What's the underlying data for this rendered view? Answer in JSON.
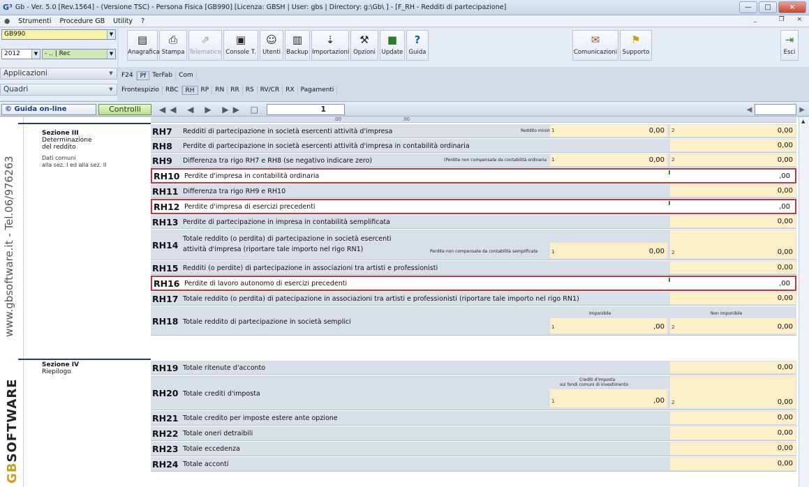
{
  "window": {
    "title": "Gb - Ver. 5.0 [Rev.1564] - (Versione TSC) - Persona Fisica [GB990]    [Licenza: GBSH | User: gbs | Directory: g:\\Gb\\ ] - [F_RH - Redditi di partecipazione]",
    "logo": "G³"
  },
  "menu": {
    "items": [
      "Strumenti",
      "Procedure GB",
      "Utility",
      "?"
    ],
    "right": "_    ❐  ×"
  },
  "left": {
    "model": "GB990",
    "year": "2012",
    "rec": "- .. | Rec",
    "applicazioni": "Applicazioni",
    "quadri": "Quadri"
  },
  "toolbar": {
    "buttons": [
      {
        "label": "Anagrafica",
        "icon": "▤"
      },
      {
        "label": "Stampa",
        "icon": "⎙"
      },
      {
        "label": "Telematico",
        "icon": "⇗"
      },
      {
        "label": "Console T.",
        "icon": "▣"
      },
      {
        "label": "Utenti",
        "icon": "☺"
      },
      {
        "label": "Backup",
        "icon": "▥"
      },
      {
        "label": "Importazioni",
        "icon": "⇣"
      },
      {
        "label": "Opzioni",
        "icon": "⚒"
      },
      {
        "label": "Update",
        "icon": "■"
      },
      {
        "label": "Guida",
        "icon": "?"
      },
      {
        "label": "Comunicazioni",
        "icon": "✉"
      },
      {
        "label": "Supporto",
        "icon": "⚑"
      },
      {
        "label": "Esci",
        "icon": "⇥"
      }
    ]
  },
  "tabs_app": [
    "F24",
    "Pf",
    "TerFab",
    "Com"
  ],
  "tabs_quadri": [
    "Frontespizio",
    "RBC",
    "RH",
    "RP",
    "RN",
    "RR",
    "RS",
    "RV/CR",
    "RX",
    "Pagamenti"
  ],
  "nav": {
    "guida": "© Guida on-line",
    "controlli": "Controlli",
    "icons": "◀◀ ◀ ▶ ▶▶ □ ☒",
    "page": "1",
    "right_icons": "◀"
  },
  "brand": {
    "url": "www.gbsoftware.it - Tel.06/976263",
    "name_gb": "GB",
    "name_rest": "SOFTWARE"
  },
  "sections": {
    "s3_title": "Sezione III",
    "s3_sub1": "Determinazione",
    "s3_sub2": "del reddito",
    "s3_note1": "Dati comuni",
    "s3_note2": "alla sez. I ed alla sez. II",
    "s4_title": "Sezione IV",
    "s4_sub": "Riepilogo"
  },
  "top_values": [
    ".00",
    ".00"
  ],
  "rows": [
    {
      "code": "RH7",
      "desc": "Redditi di partecipazione in società esercenti attività d'impresa",
      "small": "Reddito minimo",
      "f1": "0,00",
      "f2": "0,00"
    },
    {
      "code": "RH8",
      "desc": "Perdite di partecipazione in società esercenti attività d'impresa in contabilità ordinaria",
      "f2": "0,00"
    },
    {
      "code": "RH9",
      "desc": "Differenza tra rigo RH7 e RH8 (se negativo indicare zero)",
      "small": "(Perdite non compensate da contabilità ordinaria",
      "f1": "0,00",
      "f2": "0,00"
    },
    {
      "code": "RH10",
      "desc": "Perdite d'impresa in contabilità ordinaria",
      "f2": ",00"
    },
    {
      "code": "RH11",
      "desc": "Differenza tra rigo RH9 e RH10",
      "f2": "0,00"
    },
    {
      "code": "RH12",
      "desc": "Perdite d'impresa di esercizi precedenti",
      "f2": ",00"
    },
    {
      "code": "RH13",
      "desc": "Perdite di partecipazione in impresa in contabilità semplificata",
      "f2": "0,00"
    },
    {
      "code": "RH14",
      "desc1": "Totale reddito (o perdita) di partecipazione in società esercenti",
      "desc2": "attività d'impresa (riportare tale importo nel rigo RN1)",
      "small": "Perdite non compensate da contabilità semplificata",
      "f1": "0,00",
      "f2": "0,00"
    },
    {
      "code": "RH15",
      "desc": "Redditi (o perdite) di partecipazione in associazioni tra artisti e professionisti",
      "f2": "0,00"
    },
    {
      "code": "RH16",
      "desc": "Perdite di lavoro autonomo di esercizi precedenti",
      "f2": ",00"
    },
    {
      "code": "RH17",
      "desc": "Totale reddito (o perdita) di patecipazione in associazioni tra artisti e professionisti (riportare tale importo nel rigo RN1)",
      "f2": "0,00"
    },
    {
      "code": "RH18",
      "desc": "Totale reddito di partecipazione in società semplici",
      "small1": "Imponibile",
      "small2": "Non imponibile",
      "f1": ",00",
      "f2": "0,00"
    },
    {
      "code": "RH19",
      "desc": "Totale ritenute d'acconto",
      "f2": "0,00"
    },
    {
      "code": "RH20",
      "desc": "Totale crediti d'imposta",
      "small1": "Crediti d'imposta",
      "small1b": "sui fondi comuni di investimento",
      "f1": ",00",
      "f2": "0,00"
    },
    {
      "code": "RH21",
      "desc": "Totale credito per imposte estere ante opzione",
      "f2": "0,00"
    },
    {
      "code": "RH22",
      "desc": "Totale oneri detraibili",
      "f2": "0,00"
    },
    {
      "code": "RH23",
      "desc": "Totale eccedenza",
      "f2": "0,00"
    },
    {
      "code": "RH24",
      "desc": "Totale acconti",
      "f2": "0,00"
    }
  ],
  "field_nums": {
    "n1": "1",
    "n2": "2"
  },
  "colors": {
    "highlight": "#c7333a",
    "field": "#fdefc8",
    "section_line": "#223d75"
  }
}
